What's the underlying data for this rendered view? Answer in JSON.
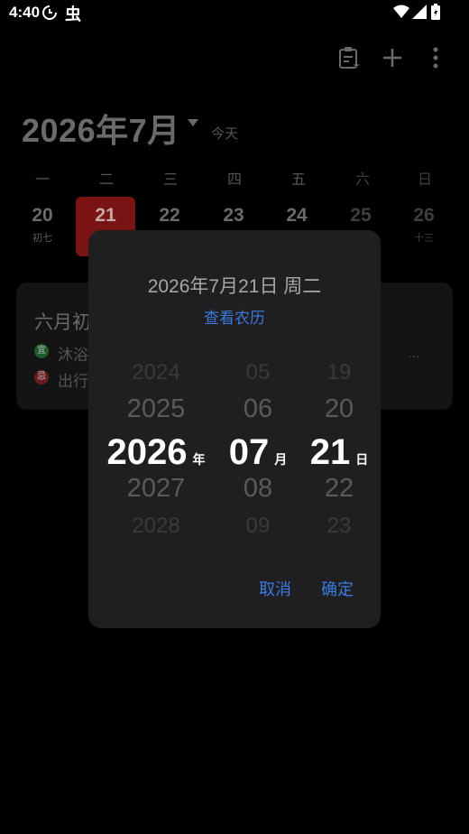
{
  "status_bar": {
    "time": "4:40",
    "app_glyph": "虫"
  },
  "toolbar": {
    "icons": [
      "note-icon",
      "add-icon",
      "more-icon"
    ]
  },
  "header": {
    "month_title": "2026年7月",
    "today_label": "今天"
  },
  "weekdays": [
    "一",
    "二",
    "三",
    "四",
    "五",
    "六",
    "日"
  ],
  "week_days": [
    {
      "num": "20",
      "lunar": "初七"
    },
    {
      "num": "21",
      "lunar": ""
    },
    {
      "num": "22",
      "lunar": ""
    },
    {
      "num": "23",
      "lunar": ""
    },
    {
      "num": "24",
      "lunar": ""
    },
    {
      "num": "25",
      "lunar": ""
    },
    {
      "num": "26",
      "lunar": "十三"
    }
  ],
  "almanac": {
    "title": "六月初",
    "yi_icon": "宜",
    "yi_text": "沐浴",
    "ji_icon": "忌",
    "ji_text": "出行",
    "ellipsis": "…"
  },
  "dialog": {
    "title": "2026年7月21日 周二",
    "lunar_link": "查看农历",
    "year": {
      "items": [
        "2024",
        "2025",
        "2026",
        "2027",
        "2028"
      ],
      "unit": "年"
    },
    "month": {
      "items": [
        "05",
        "06",
        "07",
        "08",
        "09"
      ],
      "unit": "月"
    },
    "day": {
      "items": [
        "19",
        "20",
        "21",
        "22",
        "23"
      ],
      "unit": "日"
    },
    "cancel_label": "取消",
    "confirm_label": "确定"
  },
  "colors": {
    "accent": "#3b7be0",
    "selected_day": "#7a1414",
    "dialog_bg": "#1f1f21"
  }
}
